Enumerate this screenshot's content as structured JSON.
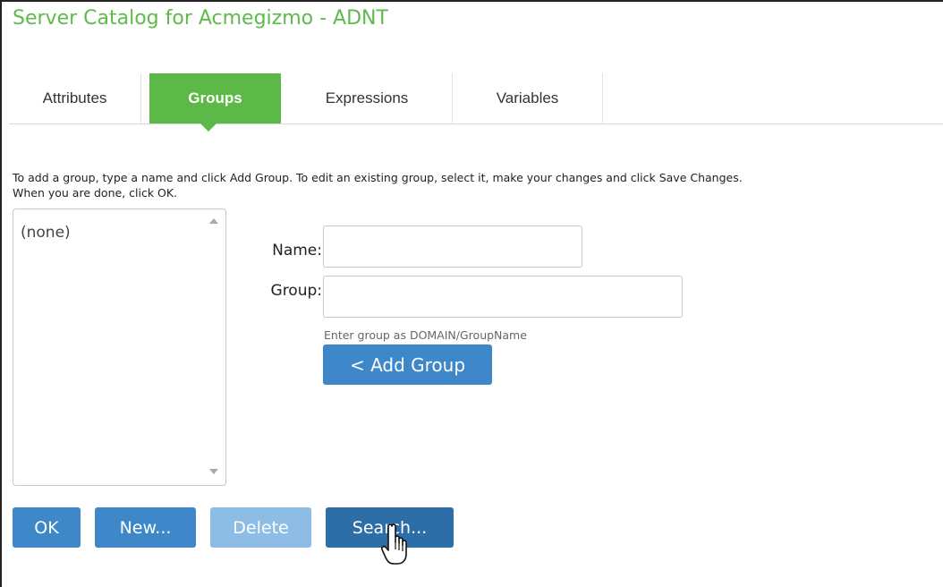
{
  "window": {
    "title": "Server Catalog for Acmegizmo - ADNT"
  },
  "tabs": [
    {
      "label": "Attributes"
    },
    {
      "label": "Groups"
    },
    {
      "label": "Expressions"
    },
    {
      "label": "Variables"
    }
  ],
  "active_tab": "Groups",
  "instructions": {
    "line1": "To add a group, type a name and click Add Group. To edit an existing group, select it, make your changes and click Save Changes.",
    "line2": "When you are done, click OK."
  },
  "group_list": {
    "items": [
      "(none)"
    ]
  },
  "form": {
    "name_label": "Name:",
    "name_value": "",
    "group_label": "Group:",
    "group_value": "",
    "hint": "Enter group as DOMAIN/GroupName",
    "add_button": "< Add Group"
  },
  "buttons": {
    "ok": "OK",
    "new": "New...",
    "delete": "Delete",
    "search": "Search..."
  },
  "colors": {
    "accent_green": "#5cb847",
    "button_blue": "#3e88ca",
    "button_disabled": "#8dbde5",
    "button_hover": "#2e6ea8"
  }
}
